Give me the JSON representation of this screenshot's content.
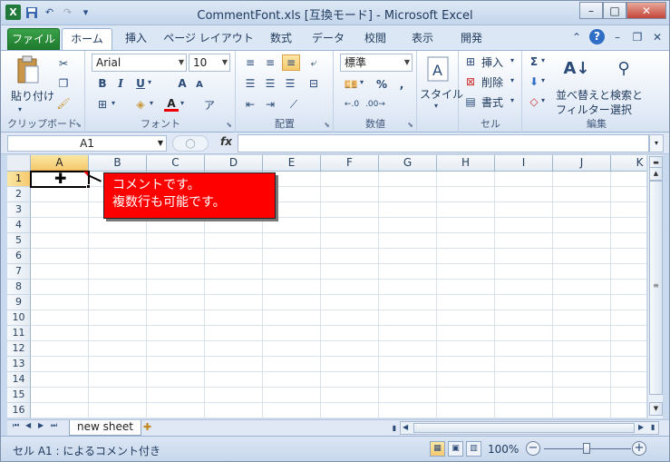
{
  "window": {
    "title": "CommentFont.xls  [互換モード] - Microsoft Excel"
  },
  "qat": {
    "icons": [
      "excel-icon",
      "save-icon",
      "undo-icon",
      "redo-icon",
      "customize-icon"
    ]
  },
  "tabs": [
    "ファイル",
    "ホーム",
    "挿入",
    "ページ レイアウト",
    "数式",
    "データ",
    "校閲",
    "表示",
    "開発"
  ],
  "ribbon": {
    "clipboard": {
      "paste": "貼り付け",
      "label": "クリップボード"
    },
    "font": {
      "name": "Arial",
      "size": "10",
      "bold": "B",
      "italic": "I",
      "underline": "U",
      "grow": "A",
      "shrink": "A",
      "fontcolor": "A",
      "label": "フォント"
    },
    "alignment": {
      "label": "配置"
    },
    "number": {
      "format": "標準",
      "percent": "%",
      "comma": ",",
      "label": "数値"
    },
    "styles": {
      "button": "スタイル"
    },
    "cells": {
      "insert": "挿入",
      "delete": "削除",
      "format": "書式",
      "label": "セル"
    },
    "editing": {
      "sort": "並べ替えと",
      "filter": "フィルター",
      "find": "検索と",
      "select": "選択",
      "label": "編集"
    }
  },
  "formula_bar": {
    "namebox": "A1",
    "fx": "fx",
    "value": ""
  },
  "sheet": {
    "columns": [
      "A",
      "B",
      "C",
      "D",
      "E",
      "F",
      "G",
      "H",
      "I",
      "J",
      "K"
    ],
    "rows": [
      "1",
      "2",
      "3",
      "4",
      "5",
      "6",
      "7",
      "8",
      "9",
      "10",
      "11",
      "12",
      "13",
      "14",
      "15",
      "16"
    ],
    "selected_cell": "A1"
  },
  "comment": {
    "line1": "コメントです。",
    "line2": "複数行も可能です。",
    "background": "#ff0000",
    "text_color": "#ffffff"
  },
  "sheet_tabs": {
    "active": "new sheet"
  },
  "status": {
    "text": "セル A1 : によるコメント付き",
    "zoom": "100%"
  }
}
